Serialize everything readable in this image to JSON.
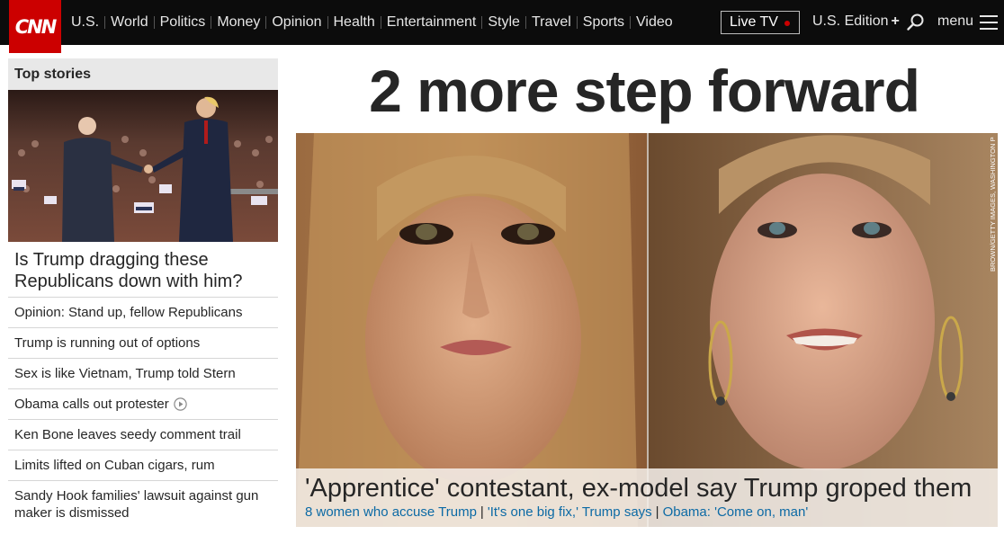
{
  "brand": {
    "logo_text": "CNN",
    "logo_color": "#cc0000"
  },
  "nav": {
    "links": [
      "U.S.",
      "World",
      "Politics",
      "Money",
      "Opinion",
      "Health",
      "Entertainment",
      "Style",
      "Travel",
      "Sports",
      "Video"
    ],
    "live_tv": "Live TV",
    "edition": "U.S. Edition",
    "edition_plus": "+",
    "menu": "menu",
    "icons": {
      "search": "search-icon",
      "menu": "hamburger-icon"
    }
  },
  "sidebar": {
    "title": "Top stories",
    "lead_headline": "Is Trump dragging these Republicans down with him?",
    "stories": [
      "Opinion: Stand up, fellow Republicans",
      "Trump is running out of options",
      "Sex is like Vietnam, Trump told Stern",
      "Obama calls out protester",
      "Ken Bone leaves seedy comment trail",
      "Limits lifted on Cuban cigars, rum",
      "Sandy Hook families' lawsuit against gun maker is dismissed"
    ]
  },
  "main": {
    "headline": "2 more step forward",
    "photo_credit": "BROWN/GETTY IMAGES, WASHINGTON POST",
    "caption": "'Apprentice' contestant, ex-model say Trump groped them",
    "related": [
      "8 women who accuse Trump",
      "'It's one big fix,' Trump says",
      "Obama: 'Come on, man'"
    ]
  },
  "colors": {
    "nav_bg": "#0c0c0c",
    "link": "#0c6aa5",
    "live_dot": "#cc0000"
  }
}
